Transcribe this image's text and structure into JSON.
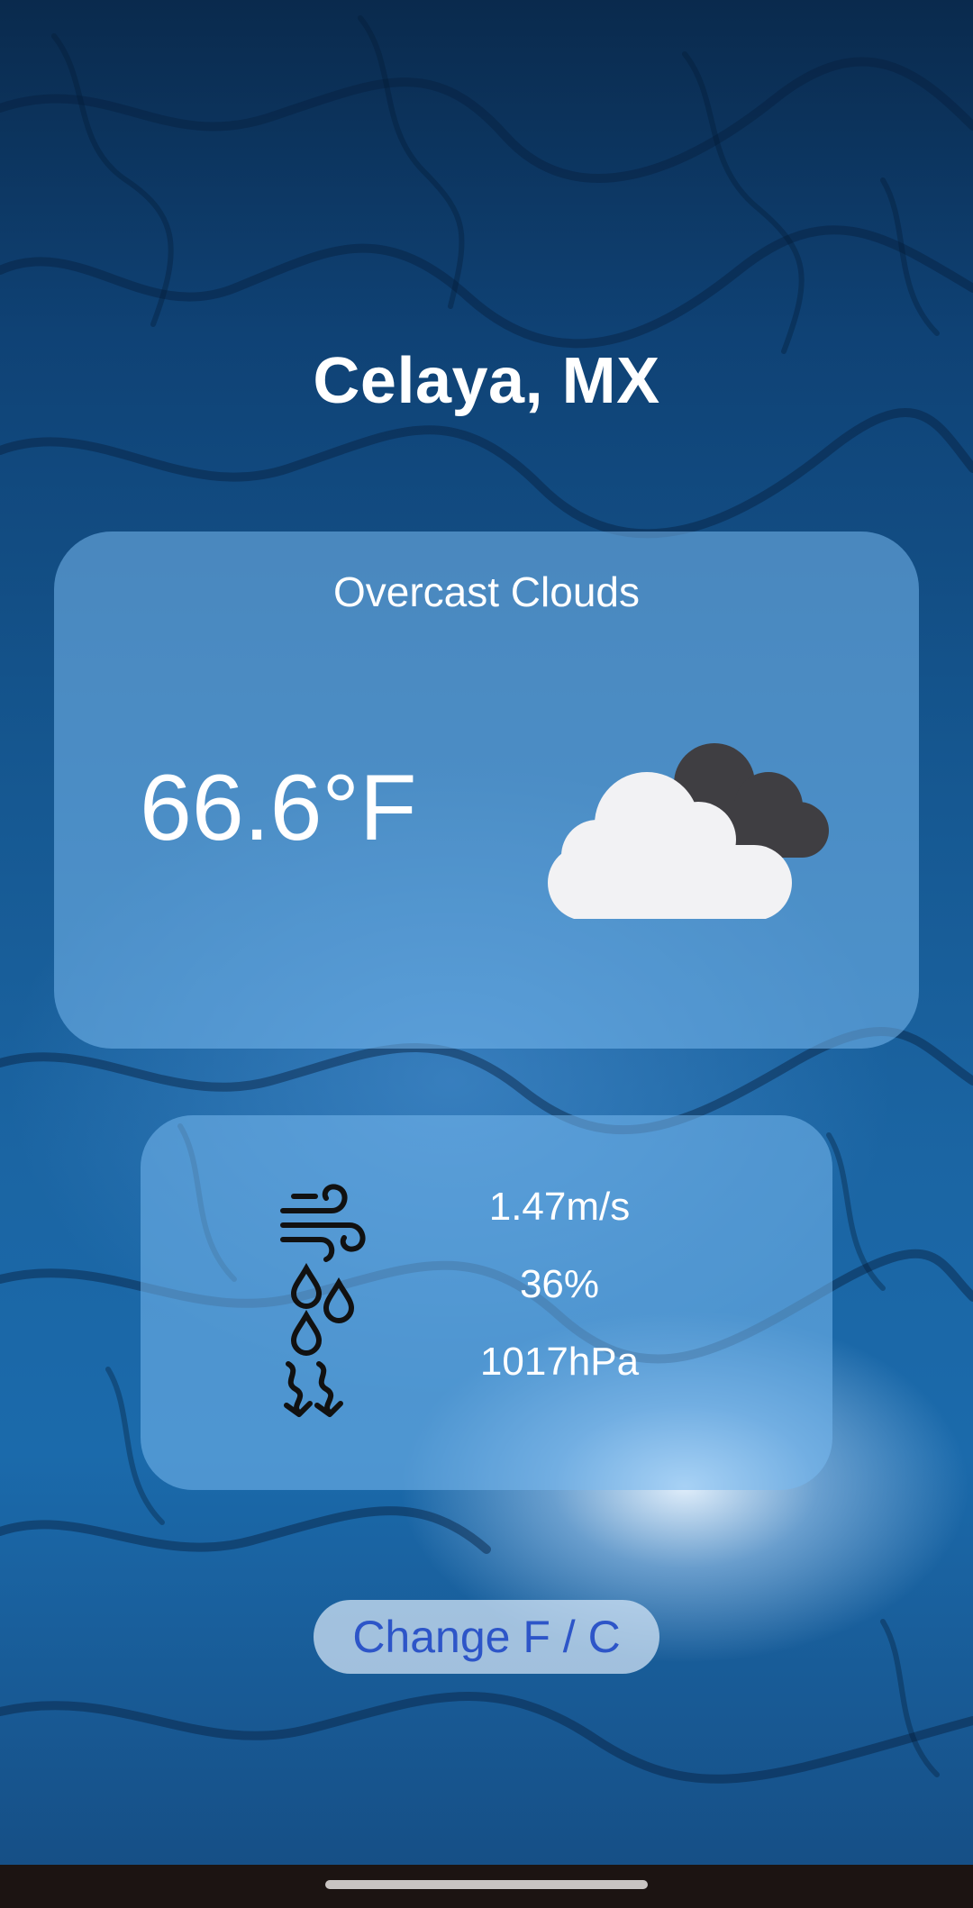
{
  "location": {
    "city": "Celaya, MX"
  },
  "current": {
    "description": "Overcast Clouds",
    "temperature": "66.6°F",
    "icon": "overcast-clouds-icon"
  },
  "details": {
    "wind": "1.47m/s",
    "humidity": "36%",
    "pressure": "1017hPa",
    "icons": [
      "wind-icon",
      "humidity-icon",
      "pressure-icon"
    ]
  },
  "controls": {
    "unit_toggle_label": "Change F / C"
  },
  "colors": {
    "card_background": "#78B9F0",
    "button_text": "#2D55C8",
    "nav_bar": "#1C1412"
  }
}
